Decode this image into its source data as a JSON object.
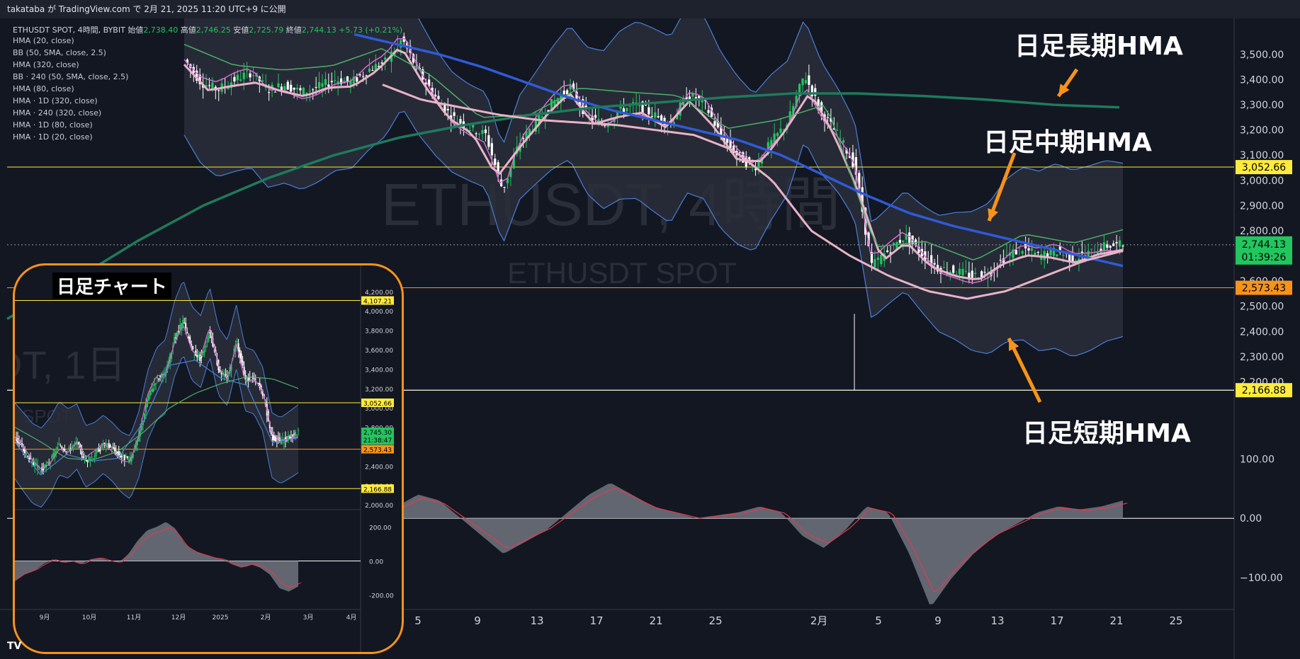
{
  "header": {
    "publish_line": "takataba が TradingView.com で 2月 21, 2025 11:20 UTC+9 に公開"
  },
  "legend": {
    "ohlc_prefix": "ETHUSDT SPOT, 4時間, BYBIT",
    "open_label": "始値",
    "open_value": "2,738.40",
    "high_label": "高値",
    "high_value": "2,746.25",
    "low_label": "安値",
    "low_value": "2,725.79",
    "close_label": "終値",
    "close_value": "2,744.13",
    "change": "+5.73 (+0.21%)",
    "indicators": [
      "HMA (20, close)",
      "BB (50, SMA, close, 2.5)",
      "HMA (320, close)",
      "BB · 240 (50, SMA, close, 2.5)",
      "HMA (80, close)",
      "HMA · 1D (320, close)",
      "HMA · 240 (320, close)",
      "HMA · 1D (80, close)",
      "HMA · 1D (20, close)"
    ]
  },
  "watermark": {
    "symbol": "ETHUSDT, 4時間",
    "sub": "ETHUSDT SPOT"
  },
  "callouts": {
    "long": "日足長期HMA",
    "mid": "日足中期HMA",
    "short": "日足短期HMA",
    "inset_title": "日足チャート"
  },
  "colors": {
    "background": "#131722",
    "bull": "#22c55e",
    "bear": "#ffffff",
    "bb_fill": "#2a2e39",
    "bb_line": "#4a7fd6",
    "hma_short": "#d76ad1",
    "hma_pink": "#e8b3c9",
    "hma_green": "#4caf6a",
    "hma_blue": "#2e5bd6",
    "hma_teal": "#1f7a5c",
    "accent_orange": "#f7931a",
    "tag_yellow": "#ffeb3b",
    "tag_green": "#22c55e",
    "tag_orange": "#f7931a"
  },
  "chart_data": [
    {
      "type": "candlestick",
      "title": "ETHUSDT SPOT, 4時間, BYBIT",
      "ylim": [
        2100,
        3570
      ],
      "y_ticks": [
        "3,500.00",
        "3,400.00",
        "3,300.00",
        "3,200.00",
        "3,100.00",
        "3,000.00",
        "2,900.00",
        "2,800.00",
        "2,700.00",
        "2,600.00",
        "2,500.00",
        "2,400.00",
        "2,300.00",
        "2,200.00"
      ],
      "x_ticks": [
        "5",
        "9",
        "13",
        "17",
        "21",
        "25",
        "2月",
        "5",
        "9",
        "13",
        "17",
        "21",
        "25"
      ],
      "price_lines": [
        {
          "label": "3,052.66",
          "value": 3052.66,
          "color": "yellow"
        },
        {
          "label": "2,573.43",
          "value": 2573.43,
          "color": "orange"
        },
        {
          "label": "2,166.88",
          "value": 2166.88,
          "color": "yellow"
        }
      ],
      "last_price": {
        "label": "2,744.13",
        "countdown": "01:39:26"
      },
      "close_path": [
        3480,
        3390,
        3360,
        3400,
        3430,
        3360,
        3380,
        3350,
        3370,
        3400,
        3390,
        3440,
        3470,
        3560,
        3430,
        3330,
        3250,
        3210,
        3180,
        2960,
        3150,
        3230,
        3310,
        3370,
        3260,
        3220,
        3280,
        3300,
        3260,
        3220,
        3340,
        3310,
        3180,
        3100,
        3050,
        3150,
        3230,
        3420,
        3270,
        3180,
        3060,
        2660,
        2720,
        2780,
        2710,
        2650,
        2640,
        2620,
        2630,
        2700,
        2730,
        2700,
        2720,
        2690,
        2710,
        2740,
        2744
      ],
      "hma_daily_long": [
        2450,
        2600,
        2760,
        2900,
        3010,
        3100,
        3170,
        3220,
        3260,
        3290,
        3310,
        3330,
        3345,
        3345,
        3335,
        3320,
        3300,
        3290
      ],
      "hma_daily_mid": [
        3580,
        3540,
        3500,
        3450,
        3390,
        3330,
        3280,
        3240,
        3200,
        3160,
        3100,
        3020,
        2940,
        2870,
        2820,
        2780,
        2740,
        2700,
        2660
      ],
      "hma_daily_short": [
        3380,
        3320,
        3290,
        3260,
        3240,
        3230,
        3220,
        3200,
        3180,
        3120,
        3000,
        2800,
        2700,
        2620,
        2560,
        2530,
        2560,
        2620,
        2680,
        2720
      ],
      "oscillator": {
        "y_ticks": [
          "100.00",
          "0.00",
          "−100.00"
        ],
        "ylim": [
          -150,
          160
        ],
        "values": [
          20,
          40,
          30,
          0,
          -30,
          -60,
          -40,
          -20,
          10,
          40,
          60,
          40,
          20,
          10,
          0,
          5,
          10,
          20,
          10,
          -30,
          -50,
          -20,
          20,
          10,
          -60,
          -150,
          -100,
          -60,
          -30,
          -10,
          10,
          20,
          15,
          20,
          30
        ]
      }
    },
    {
      "type": "candlestick",
      "title": "日足チャート",
      "ylim": [
        1950,
        4250
      ],
      "y_ticks": [
        "4,200.00",
        "4,000.00",
        "3,800.00",
        "3,600.00",
        "3,400.00",
        "3,200.00",
        "3,000.00",
        "2,800.00",
        "2,600.00",
        "2,400.00",
        "2,200.00",
        "2,000.00"
      ],
      "x_ticks": [
        "9月",
        "10月",
        "11月",
        "12月",
        "2025",
        "2月",
        "3月",
        "4月"
      ],
      "price_lines": [
        {
          "label": "4,107.21",
          "value": 4107.21,
          "color": "yellow"
        },
        {
          "label": "3,052.66",
          "value": 3052.66,
          "color": "yellow"
        },
        {
          "label": "2,573.43",
          "value": 2573.43,
          "color": "orange"
        },
        {
          "label": "2,166.88",
          "value": 2166.88,
          "color": "yellow"
        }
      ],
      "last_price": {
        "label": "2,745.30",
        "countdown": "21:38:47"
      },
      "close_path": [
        2700,
        2560,
        2420,
        2350,
        2450,
        2620,
        2560,
        2640,
        2450,
        2520,
        2630,
        2580,
        2500,
        2460,
        2700,
        3100,
        3300,
        3350,
        3700,
        3900,
        3600,
        3500,
        3800,
        3400,
        3300,
        3700,
        3300,
        3300,
        3150,
        2700,
        2650,
        2700,
        2745
      ],
      "oscillator": {
        "y_ticks": [
          "200.00",
          "0.00",
          "-200.00"
        ],
        "ylim": [
          -260,
          260
        ],
        "values": [
          -120,
          -80,
          -60,
          -20,
          10,
          -10,
          0,
          -20,
          10,
          20,
          0,
          -10,
          40,
          120,
          180,
          200,
          230,
          190,
          100,
          60,
          40,
          20,
          10,
          -20,
          -40,
          -20,
          -40,
          -80,
          -160,
          -180,
          -150
        ]
      }
    }
  ]
}
